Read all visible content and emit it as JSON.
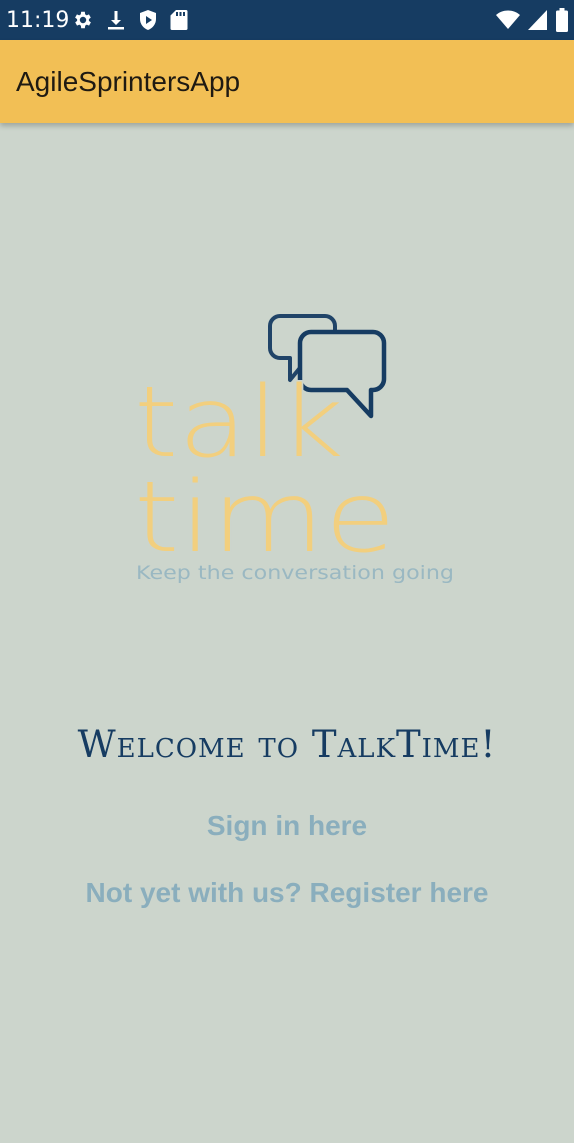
{
  "status_bar": {
    "time": "11:19",
    "left_icons": [
      "gear-icon",
      "download-icon",
      "shield-play-icon",
      "sd-card-icon"
    ],
    "right_icons": [
      "wifi-icon",
      "signal-icon",
      "battery-icon"
    ],
    "background": "#163c62"
  },
  "app_bar": {
    "title": "AgileSprintersApp",
    "background": "#f2bf55"
  },
  "logo": {
    "line1": "talk",
    "line2": "time",
    "tagline": "Keep the conversation going",
    "icon": "speech-bubbles-icon",
    "text_color": "#f2cf7e",
    "tagline_color": "#9ab8c2",
    "bubble_color": "#163c62"
  },
  "main": {
    "welcome": "Welcome to TalkTime!",
    "sign_in_link": "Sign in here",
    "register_link": "Not yet with us? Register here",
    "background": "#ccd5cc",
    "link_color": "#8aaebd"
  }
}
